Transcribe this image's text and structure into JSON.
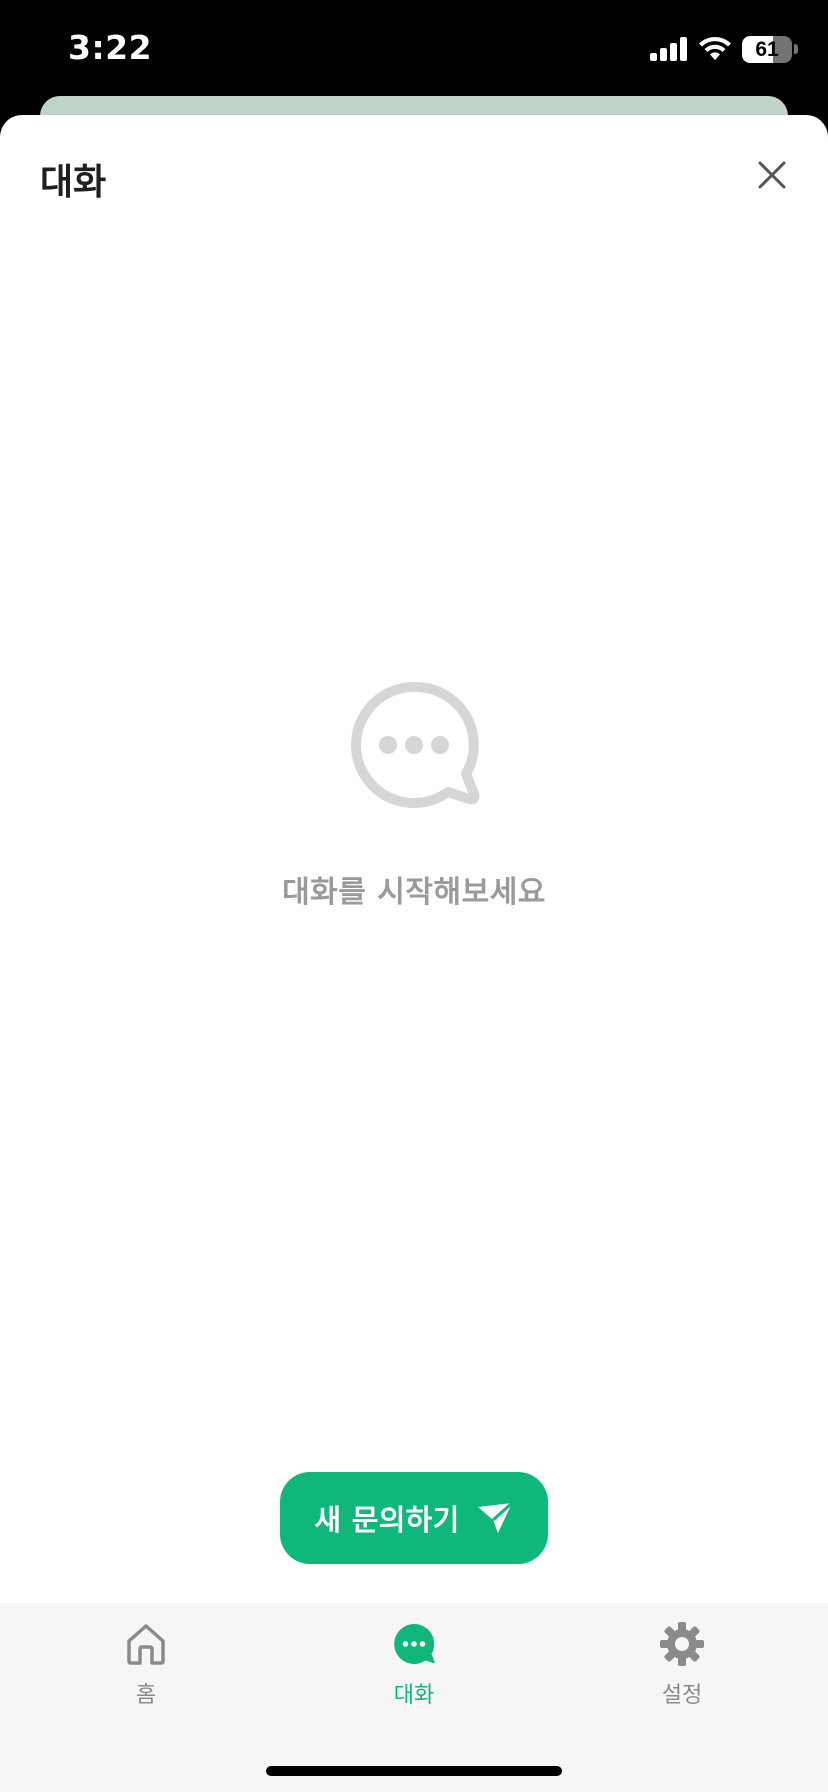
{
  "status_bar": {
    "time": "3:22",
    "battery_level": "61"
  },
  "sheet": {
    "title": "대화",
    "empty_message": "대화를 시작해보세요",
    "new_inquiry_label": "새 문의하기"
  },
  "tabs": [
    {
      "label": "홈",
      "icon": "home-icon",
      "active": false
    },
    {
      "label": "대화",
      "icon": "chat-bubble-icon",
      "active": true
    },
    {
      "label": "설정",
      "icon": "gear-icon",
      "active": false
    }
  ],
  "colors": {
    "accent": "#0fb87a",
    "empty_icon": "#d6d6d6",
    "inactive_tab": "#8a8a8a",
    "peek_card": "#bfd3c8"
  }
}
